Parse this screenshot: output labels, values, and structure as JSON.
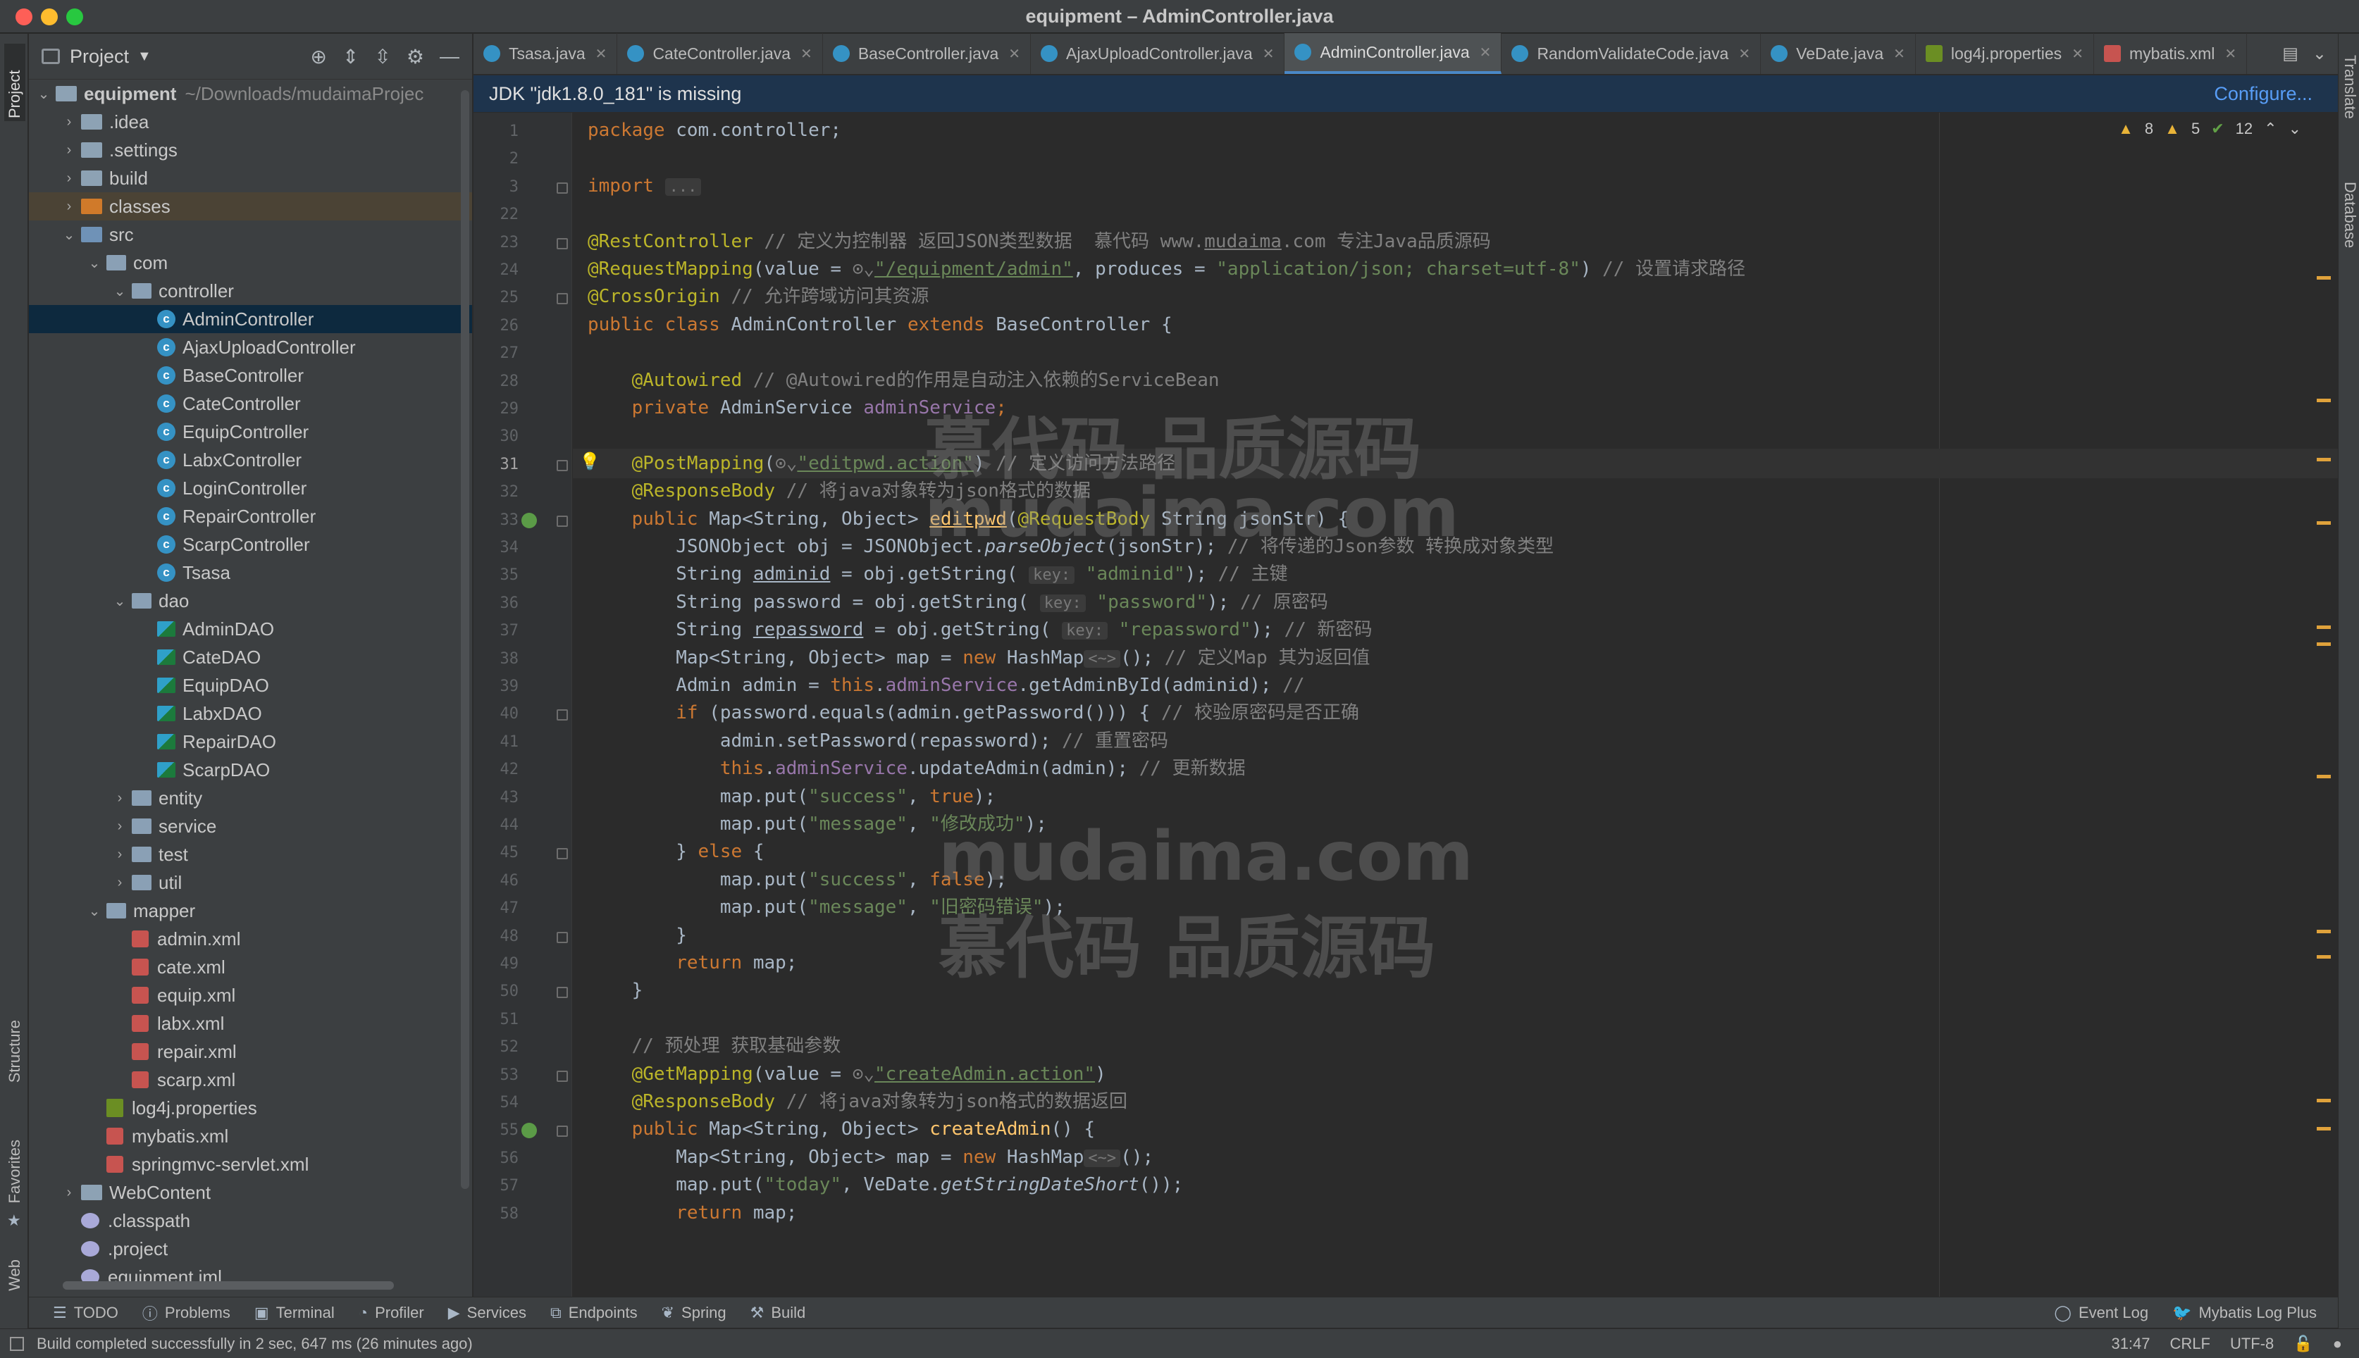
{
  "window": {
    "title": "equipment – AdminController.java"
  },
  "left_strip": {
    "project": "Project",
    "structure": "Structure",
    "favorites": "Favorites",
    "web": "Web"
  },
  "right_strip": {
    "translate": "Translate",
    "database": "Database"
  },
  "project_panel": {
    "title": "Project",
    "tree": [
      {
        "label": "equipment",
        "suffix": "~/Downloads/mudaimaProjec",
        "indent": 0,
        "arrow": "down",
        "icon": "folder"
      },
      {
        "label": ".idea",
        "indent": 1,
        "arrow": "right",
        "icon": "folder"
      },
      {
        "label": ".settings",
        "indent": 1,
        "arrow": "right",
        "icon": "folder"
      },
      {
        "label": "build",
        "indent": 1,
        "arrow": "right",
        "icon": "folder"
      },
      {
        "label": "classes",
        "indent": 1,
        "arrow": "right",
        "icon": "folder-orange",
        "state": "highlight"
      },
      {
        "label": "src",
        "indent": 1,
        "arrow": "down",
        "icon": "folder-src"
      },
      {
        "label": "com",
        "indent": 2,
        "arrow": "down",
        "icon": "package"
      },
      {
        "label": "controller",
        "indent": 3,
        "arrow": "down",
        "icon": "package"
      },
      {
        "label": "AdminController",
        "indent": 4,
        "icon": "class",
        "state": "selected"
      },
      {
        "label": "AjaxUploadController",
        "indent": 4,
        "icon": "class"
      },
      {
        "label": "BaseController",
        "indent": 4,
        "icon": "class"
      },
      {
        "label": "CateController",
        "indent": 4,
        "icon": "class"
      },
      {
        "label": "EquipController",
        "indent": 4,
        "icon": "class"
      },
      {
        "label": "LabxController",
        "indent": 4,
        "icon": "class"
      },
      {
        "label": "LoginController",
        "indent": 4,
        "icon": "class"
      },
      {
        "label": "RepairController",
        "indent": 4,
        "icon": "class"
      },
      {
        "label": "ScarpController",
        "indent": 4,
        "icon": "class"
      },
      {
        "label": "Tsasa",
        "indent": 4,
        "icon": "class"
      },
      {
        "label": "dao",
        "indent": 3,
        "arrow": "down",
        "icon": "package"
      },
      {
        "label": "AdminDAO",
        "indent": 4,
        "icon": "interface"
      },
      {
        "label": "CateDAO",
        "indent": 4,
        "icon": "interface"
      },
      {
        "label": "EquipDAO",
        "indent": 4,
        "icon": "interface"
      },
      {
        "label": "LabxDAO",
        "indent": 4,
        "icon": "interface"
      },
      {
        "label": "RepairDAO",
        "indent": 4,
        "icon": "interface"
      },
      {
        "label": "ScarpDAO",
        "indent": 4,
        "icon": "interface"
      },
      {
        "label": "entity",
        "indent": 3,
        "arrow": "right",
        "icon": "package"
      },
      {
        "label": "service",
        "indent": 3,
        "arrow": "right",
        "icon": "package"
      },
      {
        "label": "test",
        "indent": 3,
        "arrow": "right",
        "icon": "package"
      },
      {
        "label": "util",
        "indent": 3,
        "arrow": "right",
        "icon": "package"
      },
      {
        "label": "mapper",
        "indent": 2,
        "arrow": "down",
        "icon": "package"
      },
      {
        "label": "admin.xml",
        "indent": 3,
        "icon": "xml"
      },
      {
        "label": "cate.xml",
        "indent": 3,
        "icon": "xml"
      },
      {
        "label": "equip.xml",
        "indent": 3,
        "icon": "xml"
      },
      {
        "label": "labx.xml",
        "indent": 3,
        "icon": "xml"
      },
      {
        "label": "repair.xml",
        "indent": 3,
        "icon": "xml"
      },
      {
        "label": "scarp.xml",
        "indent": 3,
        "icon": "xml"
      },
      {
        "label": "log4j.properties",
        "indent": 2,
        "icon": "properties"
      },
      {
        "label": "mybatis.xml",
        "indent": 2,
        "icon": "xml"
      },
      {
        "label": "springmvc-servlet.xml",
        "indent": 2,
        "icon": "xml"
      },
      {
        "label": "WebContent",
        "indent": 1,
        "arrow": "right",
        "icon": "folder"
      },
      {
        "label": ".classpath",
        "indent": 1,
        "icon": "file"
      },
      {
        "label": ".project",
        "indent": 1,
        "icon": "file"
      },
      {
        "label": "equipment.iml",
        "indent": 1,
        "icon": "file"
      }
    ]
  },
  "tabs": [
    {
      "label": "Tsasa.java",
      "icon": "class"
    },
    {
      "label": "CateController.java",
      "icon": "class"
    },
    {
      "label": "BaseController.java",
      "icon": "class"
    },
    {
      "label": "AjaxUploadController.java",
      "icon": "class"
    },
    {
      "label": "AdminController.java",
      "icon": "class",
      "active": true
    },
    {
      "label": "RandomValidateCode.java",
      "icon": "class"
    },
    {
      "label": "VeDate.java",
      "icon": "class"
    },
    {
      "label": "log4j.properties",
      "icon": "properties"
    },
    {
      "label": "mybatis.xml",
      "icon": "xml"
    }
  ],
  "banner": {
    "message": "JDK \"jdk1.8.0_181\" is missing",
    "action": "Configure..."
  },
  "inspections": {
    "warnings": "8",
    "weak_warnings": "5",
    "ok": "12"
  },
  "watermark": {
    "line1": "慕代码 品质源码",
    "line2": "mudaima.com"
  },
  "editor": {
    "current_line": "31",
    "lines": [
      {
        "n": "1",
        "t": [
          [
            "kw",
            "package "
          ],
          [
            "",
            "com.controller;"
          ]
        ]
      },
      {
        "n": "2",
        "t": []
      },
      {
        "n": "3",
        "t": [
          [
            "kw",
            "import "
          ],
          [
            "hint",
            "..."
          ]
        ],
        "fold": true
      },
      {
        "n": "22",
        "t": []
      },
      {
        "n": "23",
        "t": [
          [
            "an",
            "@RestController"
          ],
          [
            "cm",
            " // 定义为控制器 返回JSON类型数据  慕代码 www."
          ],
          [
            "cm ul",
            "mudaima"
          ],
          [
            "cm",
            ".com 专注Java品质源码"
          ]
        ],
        "fold": true
      },
      {
        "n": "24",
        "t": [
          [
            "an",
            "@RequestMapping"
          ],
          [
            "",
            "(value = "
          ],
          [
            "cm",
            "⊙⌄"
          ],
          [
            "st ul",
            "\"/equipment/admin\""
          ],
          [
            "",
            ", produces = "
          ],
          [
            "st",
            "\"application/json; charset=utf-8\""
          ],
          [
            "",
            ") "
          ],
          [
            "cm",
            "// 设置请求路径"
          ]
        ]
      },
      {
        "n": "25",
        "t": [
          [
            "an",
            "@CrossOrigin"
          ],
          [
            "cm",
            " // 允许跨域访问其资源"
          ]
        ],
        "fold": true
      },
      {
        "n": "26",
        "t": [
          [
            "kw",
            "public class "
          ],
          [
            "",
            "AdminController "
          ],
          [
            "kw",
            "extends "
          ],
          [
            "",
            "BaseController {"
          ]
        ]
      },
      {
        "n": "27",
        "t": []
      },
      {
        "n": "28",
        "t": [
          [
            "",
            "    "
          ],
          [
            "an",
            "@Autowired"
          ],
          [
            "cm",
            " // @Autowired的作用是自动注入依赖的ServiceBean"
          ]
        ]
      },
      {
        "n": "29",
        "t": [
          [
            "",
            "    "
          ],
          [
            "kw",
            "private "
          ],
          [
            "",
            "AdminService "
          ],
          [
            "fld",
            "adminService"
          ],
          [
            "kw",
            ";"
          ]
        ]
      },
      {
        "n": "30",
        "t": []
      },
      {
        "n": "31",
        "t": [
          [
            "",
            "    "
          ],
          [
            "an",
            "@PostMapping"
          ],
          [
            "",
            "("
          ],
          [
            "cm",
            "⊙⌄"
          ],
          [
            "st ul",
            "\"editpwd.action\""
          ],
          [
            "",
            ") "
          ],
          [
            "cm",
            "// 定义访问方法路径"
          ]
        ],
        "fold": true
      },
      {
        "n": "32",
        "t": [
          [
            "",
            "    "
          ],
          [
            "an",
            "@ResponseBody"
          ],
          [
            "cm",
            " // 将java对象转为json格式的数据"
          ]
        ]
      },
      {
        "n": "33",
        "t": [
          [
            "",
            "    "
          ],
          [
            "kw",
            "public "
          ],
          [
            "",
            "Map<String, Object> "
          ],
          [
            "fn ul",
            "editpwd"
          ],
          [
            "",
            "("
          ],
          [
            "an",
            "@RequestBody "
          ],
          [
            "",
            "String jsonStr) {"
          ]
        ],
        "fold": true
      },
      {
        "n": "34",
        "t": [
          [
            "",
            "        JSONObject obj = JSONObject."
          ],
          [
            "it",
            "parseObject"
          ],
          [
            "",
            "(jsonStr); "
          ],
          [
            "cm",
            "// 将传递的Json参数 转换成对象类型"
          ]
        ]
      },
      {
        "n": "35",
        "t": [
          [
            "",
            "        String "
          ],
          [
            "ul",
            "adminid"
          ],
          [
            "",
            " = obj.getString( "
          ],
          [
            "hint",
            "key:"
          ],
          [
            "st",
            " \"adminid\""
          ],
          [
            "",
            "); "
          ],
          [
            "cm",
            "// 主键"
          ]
        ]
      },
      {
        "n": "36",
        "t": [
          [
            "",
            "        String password = obj.getString( "
          ],
          [
            "hint",
            "key:"
          ],
          [
            "st",
            " \"password\""
          ],
          [
            "",
            "); "
          ],
          [
            "cm",
            "// 原密码"
          ]
        ]
      },
      {
        "n": "37",
        "t": [
          [
            "",
            "        String "
          ],
          [
            "ul",
            "repassword"
          ],
          [
            "",
            " = obj.getString( "
          ],
          [
            "hint",
            "key:"
          ],
          [
            "st",
            " \"repassword\""
          ],
          [
            "",
            "); "
          ],
          [
            "cm",
            "// 新密码"
          ]
        ]
      },
      {
        "n": "38",
        "t": [
          [
            "",
            "        Map<String, Object> map = "
          ],
          [
            "kw",
            "new "
          ],
          [
            "",
            "HashMap"
          ],
          [
            "hint",
            "<~>"
          ],
          [
            "",
            "(); "
          ],
          [
            "cm",
            "// 定义Map 其为返回值"
          ]
        ]
      },
      {
        "n": "39",
        "t": [
          [
            "",
            "        Admin admin = "
          ],
          [
            "kw",
            "this"
          ],
          [
            "",
            "."
          ],
          [
            "fld",
            "adminService"
          ],
          [
            "",
            ".getAdminById(adminid); "
          ],
          [
            "cm",
            "//"
          ]
        ]
      },
      {
        "n": "40",
        "t": [
          [
            "",
            "        "
          ],
          [
            "kw",
            "if "
          ],
          [
            "",
            "(password.equals(admin.getPassword())) { "
          ],
          [
            "cm",
            "// 校验原密码是否正确"
          ]
        ],
        "fold": true
      },
      {
        "n": "41",
        "t": [
          [
            "",
            "            admin.setPassword(repassword); "
          ],
          [
            "cm",
            "// 重置密码"
          ]
        ]
      },
      {
        "n": "42",
        "t": [
          [
            "",
            "            "
          ],
          [
            "kw",
            "this"
          ],
          [
            "",
            "."
          ],
          [
            "fld",
            "adminService"
          ],
          [
            "",
            ".updateAdmin(admin); "
          ],
          [
            "cm",
            "// 更新数据"
          ]
        ]
      },
      {
        "n": "43",
        "t": [
          [
            "",
            "            map.put("
          ],
          [
            "st",
            "\"success\""
          ],
          [
            "",
            ", "
          ],
          [
            "kw",
            "true"
          ],
          [
            "",
            ");"
          ]
        ]
      },
      {
        "n": "44",
        "t": [
          [
            "",
            "            map.put("
          ],
          [
            "st",
            "\"message\""
          ],
          [
            "",
            ", "
          ],
          [
            "st",
            "\"修改成功\""
          ],
          [
            "",
            ");"
          ]
        ]
      },
      {
        "n": "45",
        "t": [
          [
            "",
            "        } "
          ],
          [
            "kw",
            "else "
          ],
          [
            "",
            "{"
          ]
        ],
        "fold": true
      },
      {
        "n": "46",
        "t": [
          [
            "",
            "            map.put("
          ],
          [
            "st",
            "\"success\""
          ],
          [
            "",
            ", "
          ],
          [
            "kw",
            "false"
          ],
          [
            "",
            ");"
          ]
        ]
      },
      {
        "n": "47",
        "t": [
          [
            "",
            "            map.put("
          ],
          [
            "st",
            "\"message\""
          ],
          [
            "",
            ", "
          ],
          [
            "st",
            "\"旧密码错误\""
          ],
          [
            "",
            ");"
          ]
        ]
      },
      {
        "n": "48",
        "t": [
          [
            "",
            "        }"
          ]
        ],
        "fold": true
      },
      {
        "n": "49",
        "t": [
          [
            "",
            "        "
          ],
          [
            "kw",
            "return "
          ],
          [
            "",
            "map;"
          ]
        ]
      },
      {
        "n": "50",
        "t": [
          [
            "",
            "    }"
          ]
        ],
        "fold": true
      },
      {
        "n": "51",
        "t": []
      },
      {
        "n": "52",
        "t": [
          [
            "",
            "    "
          ],
          [
            "cm",
            "// 预处理 获取基础参数"
          ]
        ]
      },
      {
        "n": "53",
        "t": [
          [
            "",
            "    "
          ],
          [
            "an",
            "@GetMapping"
          ],
          [
            "",
            "(value = "
          ],
          [
            "cm",
            "⊙⌄"
          ],
          [
            "st ul",
            "\"createAdmin.action\""
          ],
          [
            "",
            ")"
          ]
        ],
        "fold": true
      },
      {
        "n": "54",
        "t": [
          [
            "",
            "    "
          ],
          [
            "an",
            "@ResponseBody"
          ],
          [
            "cm",
            " // 将java对象转为json格式的数据返回"
          ]
        ]
      },
      {
        "n": "55",
        "t": [
          [
            "",
            "    "
          ],
          [
            "kw",
            "public "
          ],
          [
            "",
            "Map<String, Object> "
          ],
          [
            "fn",
            "createAdmin"
          ],
          [
            "",
            "() {"
          ]
        ],
        "fold": true
      },
      {
        "n": "56",
        "t": [
          [
            "",
            "        Map<String, Object> map = "
          ],
          [
            "kw",
            "new "
          ],
          [
            "",
            "HashMap"
          ],
          [
            "hint",
            "<~>"
          ],
          [
            "",
            "();"
          ]
        ]
      },
      {
        "n": "57",
        "t": [
          [
            "",
            "        map.put("
          ],
          [
            "st",
            "\"today\""
          ],
          [
            "",
            ", VeDate."
          ],
          [
            "it",
            "getStringDateShort"
          ],
          [
            "",
            "());"
          ]
        ]
      },
      {
        "n": "58",
        "t": [
          [
            "",
            "        "
          ],
          [
            "kw",
            "return "
          ],
          [
            "",
            "map;"
          ]
        ]
      }
    ]
  },
  "bottom_tools": {
    "left": [
      {
        "icon": "list-icon",
        "label": "TODO"
      },
      {
        "icon": "info-icon",
        "label": "Problems"
      },
      {
        "icon": "terminal-icon",
        "label": "Terminal"
      },
      {
        "icon": "profiler-icon",
        "label": "Profiler"
      },
      {
        "icon": "services-icon",
        "label": "Services"
      },
      {
        "icon": "endpoints-icon",
        "label": "Endpoints"
      },
      {
        "icon": "spring-icon",
        "label": "Spring"
      },
      {
        "icon": "hammer-icon",
        "label": "Build"
      }
    ],
    "right": [
      {
        "icon": "event-log-icon",
        "label": "Event Log"
      },
      {
        "icon": "mybatis-icon",
        "label": "Mybatis Log Plus"
      }
    ]
  },
  "status": {
    "message": "Build completed successfully in 2 sec, 647 ms (26 minutes ago)",
    "position": "31:47",
    "line_ending": "CRLF",
    "encoding": "UTF-8"
  },
  "colors": {
    "accent": "#4a88c7",
    "selection": "#0d293e",
    "background": "#2b2b2b"
  }
}
